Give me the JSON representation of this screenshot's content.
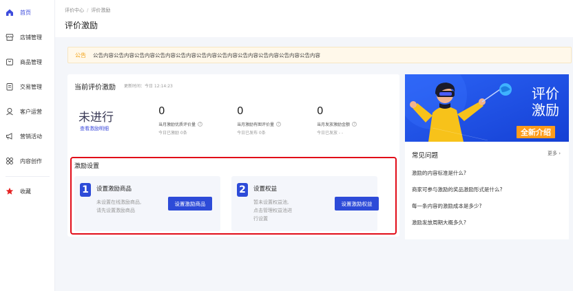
{
  "sidebar": {
    "items": [
      {
        "label": "首页",
        "icon": "home-icon"
      },
      {
        "label": "店铺管理",
        "icon": "store-icon"
      },
      {
        "label": "商品管理",
        "icon": "goods-icon"
      },
      {
        "label": "交易管理",
        "icon": "trade-icon"
      },
      {
        "label": "客户运营",
        "icon": "customer-icon"
      },
      {
        "label": "营销活动",
        "icon": "marketing-icon"
      },
      {
        "label": "内容创作",
        "icon": "content-icon"
      },
      {
        "label": "收藏",
        "icon": "star-icon"
      }
    ],
    "active_color": "#3d4bdc",
    "star_color": "#e52222"
  },
  "header": {
    "breadcrumb": [
      "评价中心",
      "评价激励"
    ],
    "breadcrumb_sep": "/",
    "title": "评价激励"
  },
  "notice": {
    "label": "公告",
    "text": "公告内容公告内容公告内容公告内容公告内容公告内容公告内容公告内容公告内容公告内容公告内容"
  },
  "current": {
    "title": "当前评价激励",
    "update_time": "更新时间：今日 12:14:23",
    "status": "未进行",
    "detail_link": "查看激励明细",
    "stats": [
      {
        "value": "0",
        "label": "当月激励优质评价量",
        "sub": "今日已激励 0条"
      },
      {
        "value": "0",
        "label": "当月激励有图评价量",
        "sub": "今日已发布 0条"
      },
      {
        "value": "0",
        "label": "当月发放激励金额",
        "sub": "今日已发放 - -"
      }
    ],
    "help_glyph": "?"
  },
  "setup": {
    "title": "激励设置",
    "steps": [
      {
        "num": "1",
        "name": "设置激励商品",
        "desc": [
          "未设置在线激励商品,",
          "请先设置激励商品"
        ],
        "button": "设置激励商品"
      },
      {
        "num": "2",
        "name": "设置权益",
        "desc": [
          "暂未设置权益池,",
          "点击管理权益池进",
          "行设置"
        ],
        "button": "设置激励权益"
      }
    ]
  },
  "banner": {
    "line1": "评价",
    "line2": "激励",
    "button": "全新介绍"
  },
  "faq": {
    "title": "常见问题",
    "more": "更多",
    "items": [
      "激励的内容标准是什么?",
      "商家可参与激励的奖品激励形式是什么?",
      "每一条内容的激励成本是多少?",
      "激励发放周期大概多久?"
    ]
  },
  "colors": {
    "primary": "#2d4bd8",
    "highlight_box": "#e10b17",
    "notice_label": "#f2a114",
    "banner_bg": "#1f54f0",
    "banner_btn": "#ff9c1a"
  }
}
